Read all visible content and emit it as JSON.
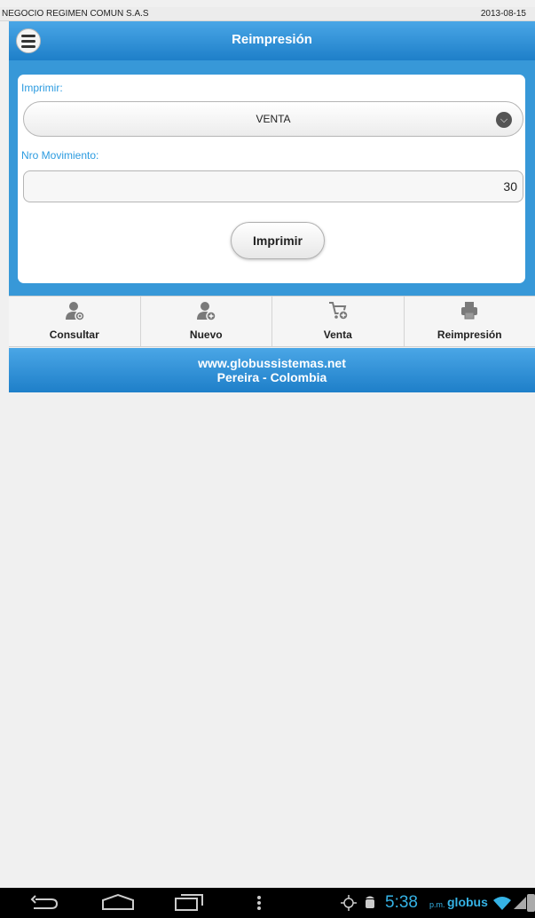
{
  "status_strip": {
    "company": "NEGOCIO REGIMEN COMUN S.A.S",
    "date": "2013-08-15"
  },
  "header": {
    "title": "Reimpresión"
  },
  "form": {
    "print_label": "Imprimir:",
    "print_selected": "VENTA",
    "movement_label": "Nro Movimiento:",
    "movement_value": "30",
    "print_button": "Imprimir"
  },
  "tabs": [
    {
      "label": "Consultar",
      "icon": "user-search-icon"
    },
    {
      "label": "Nuevo",
      "icon": "user-add-icon"
    },
    {
      "label": "Venta",
      "icon": "cart-add-icon"
    },
    {
      "label": "Reimpresión",
      "icon": "printer-icon"
    }
  ],
  "footer": {
    "website": "www.globussistemas.net",
    "location": "Pereira - Colombia"
  },
  "system_bar": {
    "time": "5:38",
    "ampm": "p.m.",
    "carrier": "globus"
  },
  "colors": {
    "accent_blue": "#2b9be0",
    "header_blue": "#1e7fc9",
    "clock_blue": "#35b3e6"
  }
}
